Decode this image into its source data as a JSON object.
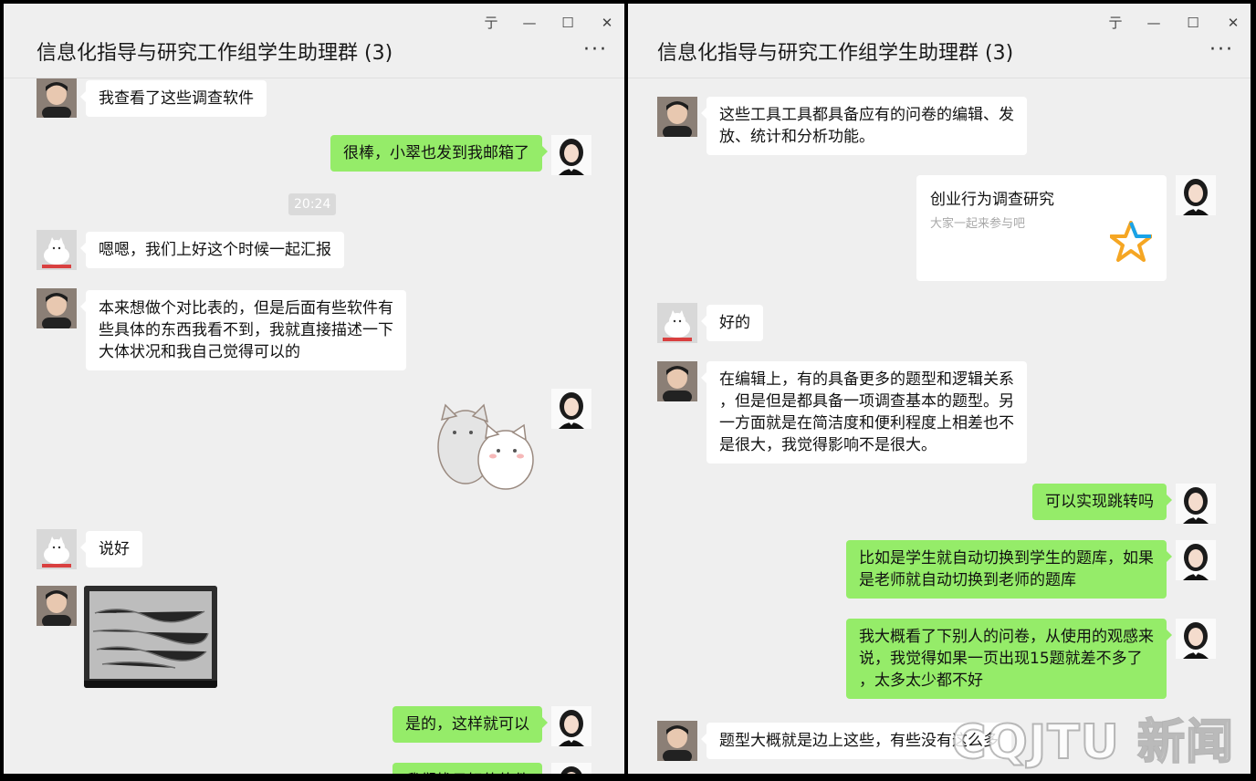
{
  "windows": {
    "left": {
      "title": "信息化指导与研究工作组学生助理群 (3)",
      "messages": {
        "m1": "我查看了这些调查软件",
        "m2": "很棒，小翠也发到我邮箱了",
        "time": "20:24",
        "m3": "嗯嗯，我们上好这个时候一起汇报",
        "m4": [
          "本来想做个对比表的，但是后面有些软件有",
          "些具体的东西我看不到，我就直接描述一下",
          "大体状况和我自己觉得可以的"
        ],
        "m5": "说好",
        "m6": "是的，这样就可以",
        "m7": "我们找日好的软件"
      }
    },
    "right": {
      "title": "信息化指导与研究工作组学生助理群 (3)",
      "messages": {
        "r1": [
          "这些工具工具都具备应有的问卷的编辑、发",
          "放、统计和分析功能。"
        ],
        "card_title": "创业行为调查研究",
        "card_desc": "大家一起来参与吧",
        "r2": "好的",
        "r3": [
          "在编辑上，有的具备更多的题型和逻辑关系",
          "，但是但是都具备一项调查基本的题型。另",
          "一方面就是在简洁度和便利程度上相差也不",
          "是很大，我觉得影响不是很大。"
        ],
        "r4": "可以实现跳转吗",
        "r5": [
          "比如是学生就自动切换到学生的题库，如果",
          "是老师就自动切换到老师的题库"
        ],
        "r6": [
          "我大概看了下别人的问卷，从使用的观感来",
          "说，我觉得如果一页出现15题就差不多了",
          "，太多太少都不好"
        ],
        "r7": "题型大概就是边上这些，有些没有这么多"
      }
    }
  },
  "controls": {
    "pin": "亍",
    "minimize": "—",
    "maximize": "☐",
    "close": "✕",
    "more": "···"
  },
  "watermark": "CQJTU 新闻",
  "colors": {
    "out_bubble": "#95ec69",
    "in_bubble": "#ffffff",
    "window_bg": "#efefef"
  }
}
